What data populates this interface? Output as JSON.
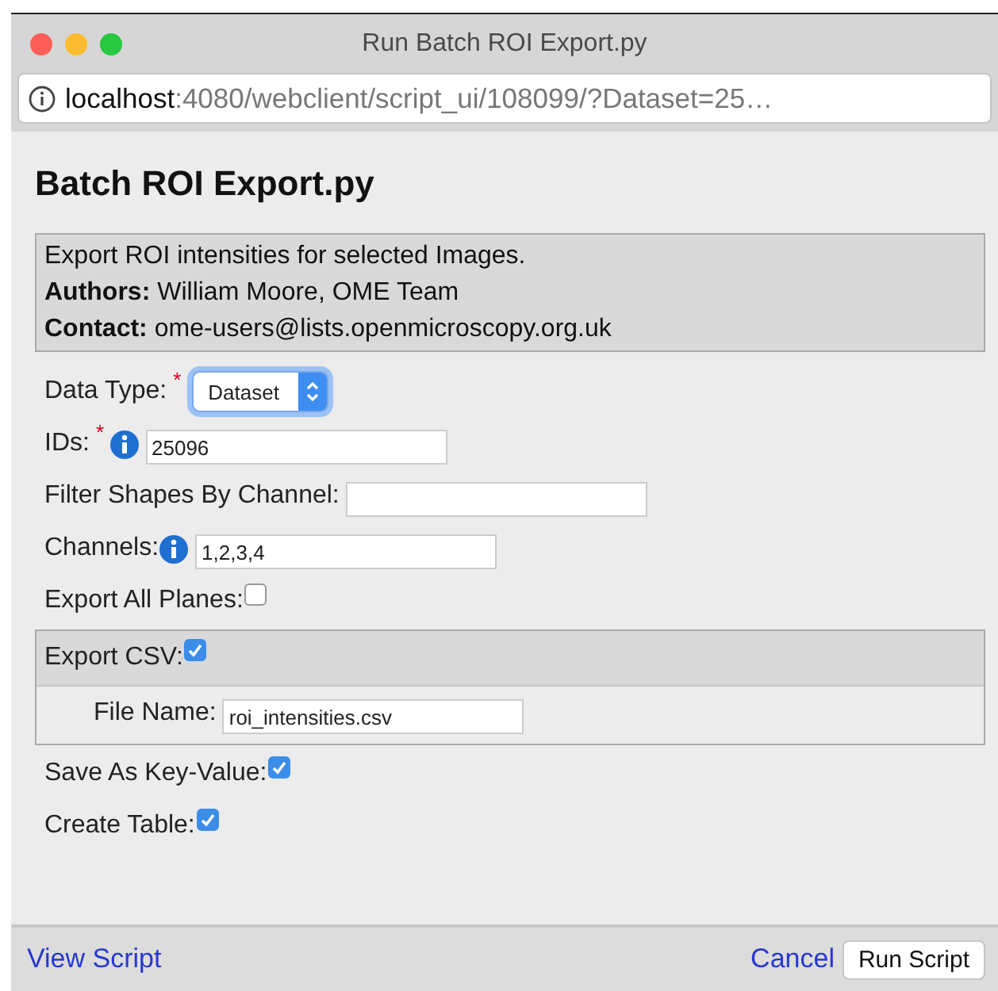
{
  "window": {
    "title": "Run Batch ROI Export.py"
  },
  "address_bar": {
    "host": "localhost",
    "path": ":4080/webclient/script_ui/108099/?Dataset=25…"
  },
  "script": {
    "title": "Batch ROI Export.py",
    "description": [
      "Export ROI intensities for selected Images.",
      "**Authors:** William Moore, OME Team",
      "**Contact:** ome-users@lists.openmicroscopy.org.uk"
    ]
  },
  "fields": [
    {
      "kind": "select",
      "label": "Data Type:",
      "required_mark": "*",
      "info": false,
      "value": "Dataset"
    },
    {
      "kind": "text",
      "label": "IDs:",
      "required_mark": "*",
      "info": true,
      "value": "25096"
    },
    {
      "kind": "text",
      "label": "Filter Shapes By Channel:",
      "info": false
    },
    {
      "kind": "text",
      "label": "Channels:",
      "info": true,
      "value": "1,2,3,4"
    },
    {
      "kind": "checkbox",
      "label": "Export All Planes:",
      "info": false,
      "checked": false
    },
    {
      "kind": "group",
      "label": "Export CSV:",
      "info": false,
      "checked": true,
      "children": [
        {
          "kind": "text",
          "label": "File Name:",
          "info": false,
          "value": "roi_intensities.csv"
        }
      ]
    },
    {
      "kind": "checkbox",
      "label": "Save As Key-Value:",
      "info": false,
      "checked": true
    },
    {
      "kind": "checkbox",
      "label": "Create Table:",
      "info": false,
      "checked": true
    }
  ],
  "footer": {
    "link": "View Script",
    "cancel": "Cancel",
    "run": "Run Script"
  }
}
